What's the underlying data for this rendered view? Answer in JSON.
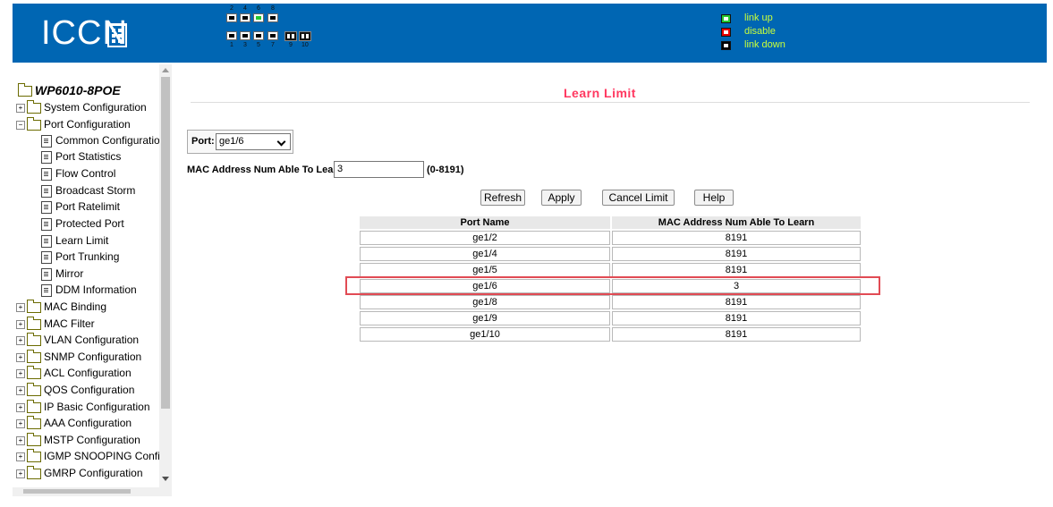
{
  "header": {
    "logo_text": "ICCN",
    "panel": {
      "top_numbers": [
        "2",
        "4",
        "6",
        "8"
      ],
      "bottom_numbers": [
        "1",
        "3",
        "5",
        "7",
        "9",
        "10"
      ]
    },
    "legend": [
      {
        "label": "link up",
        "color": "#27c92f"
      },
      {
        "label": "disable",
        "color": "#e60000"
      },
      {
        "label": "link down",
        "color": "#000000"
      }
    ]
  },
  "sidebar": {
    "root": "WP6010-8POE",
    "items": [
      {
        "label": "System Configuration",
        "type": "folder"
      },
      {
        "label": "Port Configuration",
        "type": "folder-open"
      },
      {
        "label": "Common Configuration",
        "type": "page"
      },
      {
        "label": "Port Statistics",
        "type": "page"
      },
      {
        "label": "Flow Control",
        "type": "page"
      },
      {
        "label": "Broadcast Storm",
        "type": "page"
      },
      {
        "label": "Port Ratelimit",
        "type": "page"
      },
      {
        "label": "Protected Port",
        "type": "page"
      },
      {
        "label": "Learn Limit",
        "type": "page"
      },
      {
        "label": "Port Trunking",
        "type": "page"
      },
      {
        "label": "Mirror",
        "type": "page"
      },
      {
        "label": "DDM Information",
        "type": "page"
      },
      {
        "label": "MAC Binding",
        "type": "folder"
      },
      {
        "label": "MAC Filter",
        "type": "folder"
      },
      {
        "label": "VLAN Configuration",
        "type": "folder"
      },
      {
        "label": "SNMP Configuration",
        "type": "folder"
      },
      {
        "label": "ACL Configuration",
        "type": "folder"
      },
      {
        "label": "QOS Configuration",
        "type": "folder"
      },
      {
        "label": "IP Basic Configuration",
        "type": "folder"
      },
      {
        "label": "AAA Configuration",
        "type": "folder"
      },
      {
        "label": "MSTP Configuration",
        "type": "folder"
      },
      {
        "label": "IGMP SNOOPING Configu",
        "type": "folder"
      },
      {
        "label": "GMRP Configuration",
        "type": "folder"
      }
    ]
  },
  "main": {
    "title": "Learn Limit",
    "port_label": "Port:",
    "port_value": "ge1/6",
    "mac_label": "MAC Address Num Able To Learn:",
    "mac_value": "3",
    "mac_range": "(0-8191)",
    "buttons": {
      "refresh": "Refresh",
      "apply": "Apply",
      "cancel": "Cancel Limit",
      "help": "Help"
    },
    "table": {
      "headers": [
        "Port Name",
        "MAC Address Num Able To Learn"
      ],
      "rows": [
        [
          "ge1/2",
          "8191"
        ],
        [
          "ge1/4",
          "8191"
        ],
        [
          "ge1/5",
          "8191"
        ],
        [
          "ge1/6",
          "3"
        ],
        [
          "ge1/8",
          "8191"
        ],
        [
          "ge1/9",
          "8191"
        ],
        [
          "ge1/10",
          "8191"
        ]
      ]
    }
  }
}
